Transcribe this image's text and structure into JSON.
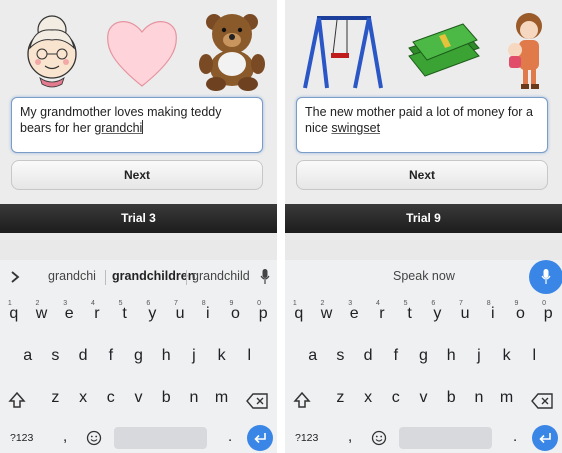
{
  "left": {
    "images": [
      "grandmother",
      "heart",
      "teddy-bear"
    ],
    "text_before": "My grandmother loves making teddy bears for her ",
    "text_current": "grandchi",
    "next_label": "Next",
    "trial_label": "Trial 3",
    "suggestions": [
      "grandchi",
      "grandchildren",
      "grandchild"
    ]
  },
  "right": {
    "images": [
      "swing-set",
      "money",
      "mother-with-baby"
    ],
    "text_before": "The new mother paid a lot of money for a nice ",
    "text_current": "swingset",
    "next_label": "Next",
    "trial_label": "Trial 9",
    "speak_label": "Speak now"
  },
  "keyboard": {
    "row1": [
      "q",
      "w",
      "e",
      "r",
      "t",
      "y",
      "u",
      "i",
      "o",
      "p"
    ],
    "row1_hints": [
      "1",
      "2",
      "3",
      "4",
      "5",
      "6",
      "7",
      "8",
      "9",
      "0"
    ],
    "row2": [
      "a",
      "s",
      "d",
      "f",
      "g",
      "h",
      "j",
      "k",
      "l"
    ],
    "row3": [
      "z",
      "x",
      "c",
      "v",
      "b",
      "n",
      "m"
    ],
    "symbols_label": "?123",
    "comma": ",",
    "period": "."
  },
  "colors": {
    "accent": "#3a86e6",
    "trial_bar": "#222222",
    "panel_bg": "#ececec"
  }
}
